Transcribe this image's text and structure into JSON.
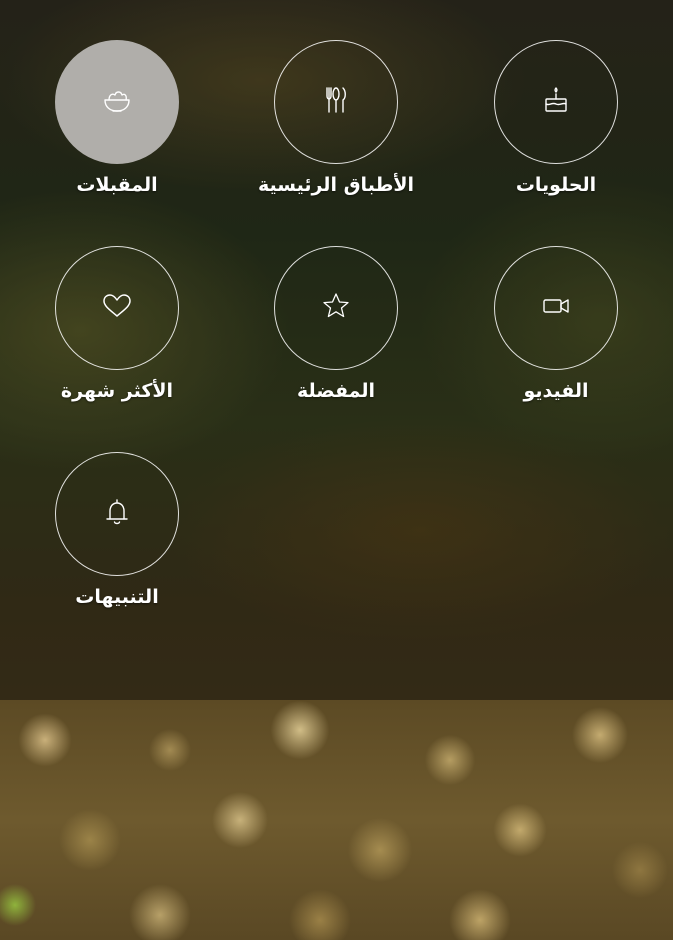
{
  "menu": {
    "items": [
      {
        "label": "المقبلات",
        "icon": "bowl-icon",
        "active": true
      },
      {
        "label": "الأطباق الرئيسية",
        "icon": "cutlery-icon",
        "active": false
      },
      {
        "label": "الحلويات",
        "icon": "cake-icon",
        "active": false
      },
      {
        "label": "الأكثر شهرة",
        "icon": "heart-icon",
        "active": false
      },
      {
        "label": "المفضلة",
        "icon": "star-icon",
        "active": false
      },
      {
        "label": "الفيديو",
        "icon": "video-camera-icon",
        "active": false
      },
      {
        "label": "التنبيهات",
        "icon": "bell-icon",
        "active": false
      }
    ]
  },
  "colors": {
    "active_circle": "#b0aeaa",
    "ring": "#ffffff"
  }
}
